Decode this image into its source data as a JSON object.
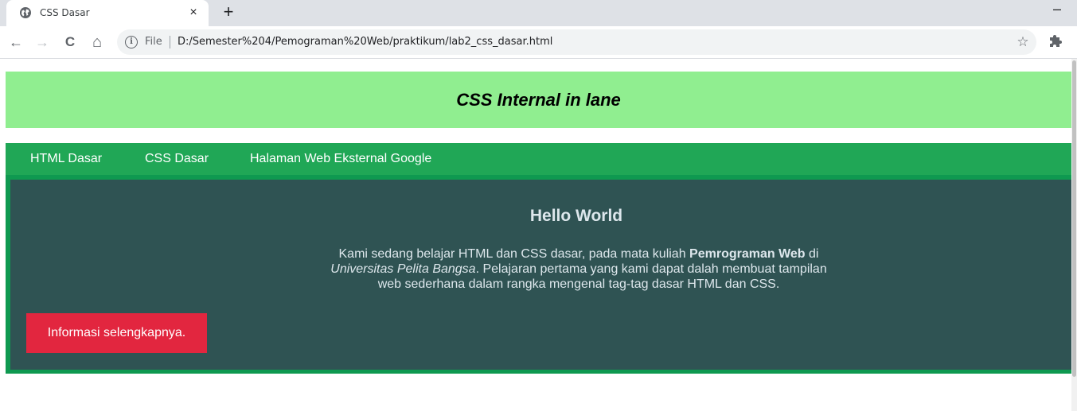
{
  "browser": {
    "tab_title": "CSS Dasar",
    "tab_close": "×",
    "new_tab": "+",
    "minimize": "–",
    "back": "←",
    "forward": "→",
    "reload": "C",
    "home": "⌂",
    "url_scheme_label": "File",
    "url": "D:/Semester%204/Pemograman%20Web/praktikum/lab2_css_dasar.html",
    "bookmark_star": "☆",
    "icons": [
      "globe-icon",
      "close-icon",
      "plus-icon",
      "minimize-icon",
      "back-arrow-icon",
      "forward-arrow-icon",
      "reload-icon",
      "home-icon",
      "info-icon",
      "star-icon",
      "puzzle-icon"
    ]
  },
  "page": {
    "header_title": "CSS Internal in lane",
    "nav": [
      {
        "label": "HTML Dasar"
      },
      {
        "label": "CSS Dasar"
      },
      {
        "label": "Halaman Web Eksternal Google"
      }
    ],
    "main": {
      "heading": "Hello World",
      "intro_before_bold": "Kami sedang belajar HTML dan CSS dasar, pada mata kuliah ",
      "intro_bold": "Pemrograman Web",
      "intro_between": " di ",
      "intro_italic": "Universitas Pelita Bangsa",
      "intro_after": ". Pelajaran pertama yang kami dapat dalah membuat tampilan web sederhana dalam rangka mengenal tag-tag dasar HTML dan CSS."
    },
    "button_label": "Informasi selengkapnya."
  },
  "colors": {
    "header_bg": "#90ee90",
    "nav_bg": "#20a756",
    "main_bg": "#2f5353",
    "main_border": "#0f9950",
    "button_bg": "#e2263f"
  }
}
